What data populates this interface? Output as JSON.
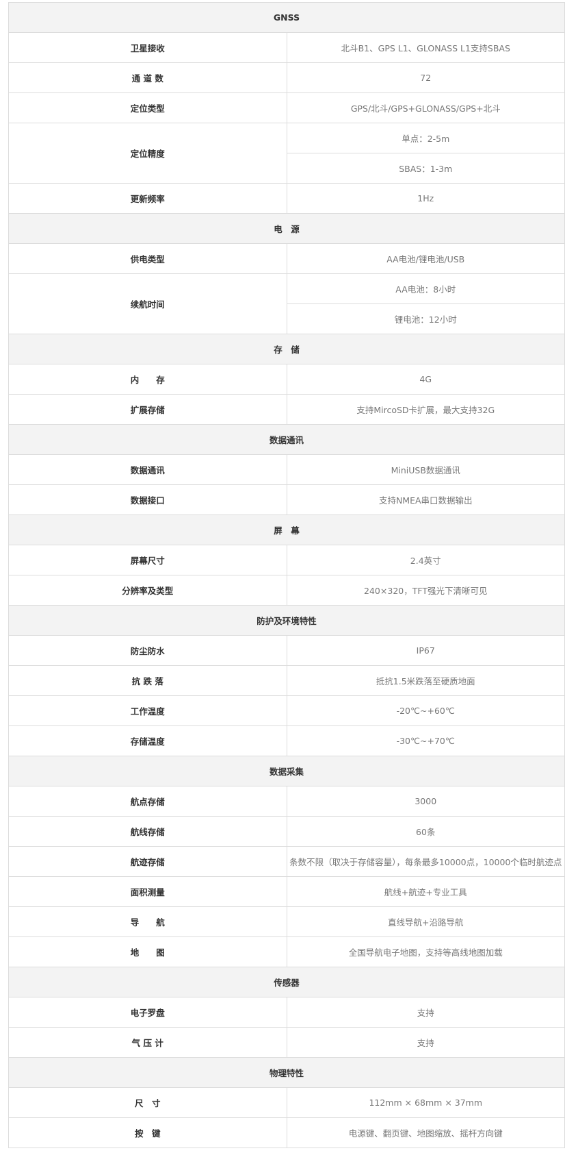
{
  "spec_table": {
    "rows": [
      {
        "type": "section",
        "title": "GNSS"
      },
      {
        "type": "row",
        "label": "卫星接收",
        "values": [
          "北斗B1、GPS L1、GLONASS L1支持SBAS"
        ]
      },
      {
        "type": "row",
        "label": "通 道 数",
        "values": [
          "72"
        ]
      },
      {
        "type": "row",
        "label": "定位类型",
        "values": [
          "GPS/北斗/GPS+GLONASS/GPS+北斗"
        ]
      },
      {
        "type": "row",
        "label": "定位精度",
        "values": [
          "单点：2-5m",
          "SBAS：1-3m"
        ]
      },
      {
        "type": "row",
        "label": "更新频率",
        "values": [
          "1Hz"
        ]
      },
      {
        "type": "section",
        "title": "电　源"
      },
      {
        "type": "row",
        "label": "供电类型",
        "values": [
          "AA电池/锂电池/USB"
        ]
      },
      {
        "type": "row",
        "label": "续航时间",
        "values": [
          "AA电池：8小时",
          "锂电池：12小时"
        ]
      },
      {
        "type": "section",
        "title": "存　储"
      },
      {
        "type": "row",
        "label": "内　　存",
        "values": [
          "4G"
        ]
      },
      {
        "type": "row",
        "label": "扩展存储",
        "values": [
          "支持MircoSD卡扩展，最大支持32G"
        ]
      },
      {
        "type": "section",
        "title": "数据通讯"
      },
      {
        "type": "row",
        "label": "数据通讯",
        "values": [
          "MiniUSB数据通讯"
        ]
      },
      {
        "type": "row",
        "label": "数据接口",
        "values": [
          "支持NMEA串口数据输出"
        ]
      },
      {
        "type": "section",
        "title": "屏　幕"
      },
      {
        "type": "row",
        "label": "屏幕尺寸",
        "values": [
          "2.4英寸"
        ]
      },
      {
        "type": "row",
        "label": "分辨率及类型",
        "values": [
          "240×320，TFT强光下清晰可见"
        ]
      },
      {
        "type": "section",
        "title": "防护及环境特性"
      },
      {
        "type": "row",
        "label": "防尘防水",
        "values": [
          "IP67"
        ]
      },
      {
        "type": "row",
        "label": "抗 跌 落",
        "values": [
          "抵抗1.5米跌落至硬质地面"
        ]
      },
      {
        "type": "row",
        "label": "工作温度",
        "values": [
          "-20℃~+60℃"
        ]
      },
      {
        "type": "row",
        "label": "存储温度",
        "values": [
          "-30℃~+70℃"
        ]
      },
      {
        "type": "section",
        "title": "数据采集"
      },
      {
        "type": "row",
        "label": "航点存储",
        "values": [
          "3000"
        ]
      },
      {
        "type": "row",
        "label": "航线存储",
        "values": [
          "60条"
        ]
      },
      {
        "type": "row",
        "label": "航迹存储",
        "values": [
          "条数不限（取决于存储容量），每条最多10000点，10000个临时航迹点"
        ]
      },
      {
        "type": "row",
        "label": "面积测量",
        "values": [
          "航线+航迹+专业工具"
        ]
      },
      {
        "type": "row",
        "label": "导　　航",
        "values": [
          "直线导航+沿路导航"
        ]
      },
      {
        "type": "row",
        "label": "地　　图",
        "values": [
          "全国导航电子地图，支持等高线地图加载"
        ]
      },
      {
        "type": "section",
        "title": "传感器"
      },
      {
        "type": "row",
        "label": "电子罗盘",
        "values": [
          "支持"
        ]
      },
      {
        "type": "row",
        "label": "气 压 计",
        "values": [
          "支持"
        ]
      },
      {
        "type": "section",
        "title": "物理特性"
      },
      {
        "type": "row",
        "label": "尺　寸",
        "values": [
          "112mm × 68mm × 37mm"
        ]
      },
      {
        "type": "row",
        "label": "按　键",
        "values": [
          "电源键、翻页键、地图缩放、摇杆方向键"
        ]
      }
    ]
  }
}
